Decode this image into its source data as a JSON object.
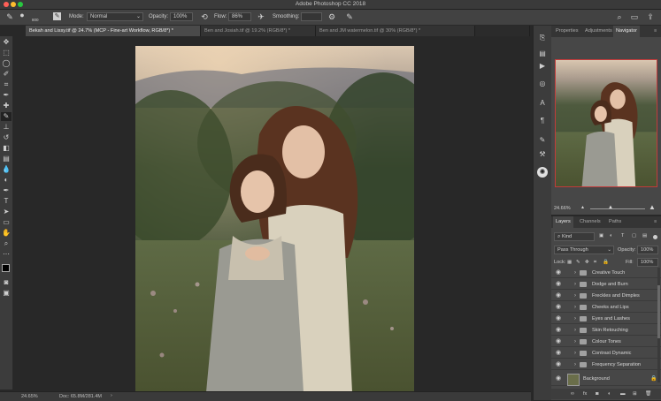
{
  "window": {
    "title": "Adobe Photoshop CC 2018"
  },
  "options_bar": {
    "brush_size": "800",
    "mode_label": "Mode:",
    "mode_value": "Normal",
    "opacity_label": "Opacity:",
    "opacity_value": "100%",
    "flow_label": "Flow:",
    "flow_value": "86%",
    "smoothing_label": "Smoothing:"
  },
  "tabs": [
    {
      "label": "Bekah and Lissy.tif @ 24.7% (MCP - Fine-art Workflow, RGB/8*) *",
      "close": "×"
    },
    {
      "label": "Ben and Josiah.tif @ 19.2% (RGB/8*) *",
      "close": "×"
    },
    {
      "label": "Ben and JM watermelon.tif @ 30% (RGB/8*) *",
      "close": "×"
    }
  ],
  "status": {
    "zoom": "24.65%",
    "doc": "Doc: 65.8M/281.4M"
  },
  "navigator_panel": {
    "tabs": [
      "Properties",
      "Adjustments",
      "Navigator"
    ],
    "zoom": "24.66%"
  },
  "layers_panel": {
    "tabs": [
      "Layers",
      "Channels",
      "Paths"
    ],
    "kind_label": "Kind",
    "blend_mode": "Pass Through",
    "opacity_label": "Opacity:",
    "opacity_value": "100%",
    "lock_label": "Lock:",
    "fill_label": "Fill:",
    "fill_value": "100%",
    "layers": [
      {
        "name": "Creative Touch"
      },
      {
        "name": "Dodge and Burn"
      },
      {
        "name": "Freckles and Dimples"
      },
      {
        "name": "Cheeks and Lips"
      },
      {
        "name": "Eyes and Lashes"
      },
      {
        "name": "Skin Retouching"
      },
      {
        "name": "Colour Tones"
      },
      {
        "name": "Contrast Dynamic"
      },
      {
        "name": "Frequency Separation"
      }
    ],
    "background_layer": "Background"
  },
  "colors": {
    "accent_red": "#c23b3b",
    "panel_bg": "#474747",
    "canvas_bg": "#282828"
  }
}
